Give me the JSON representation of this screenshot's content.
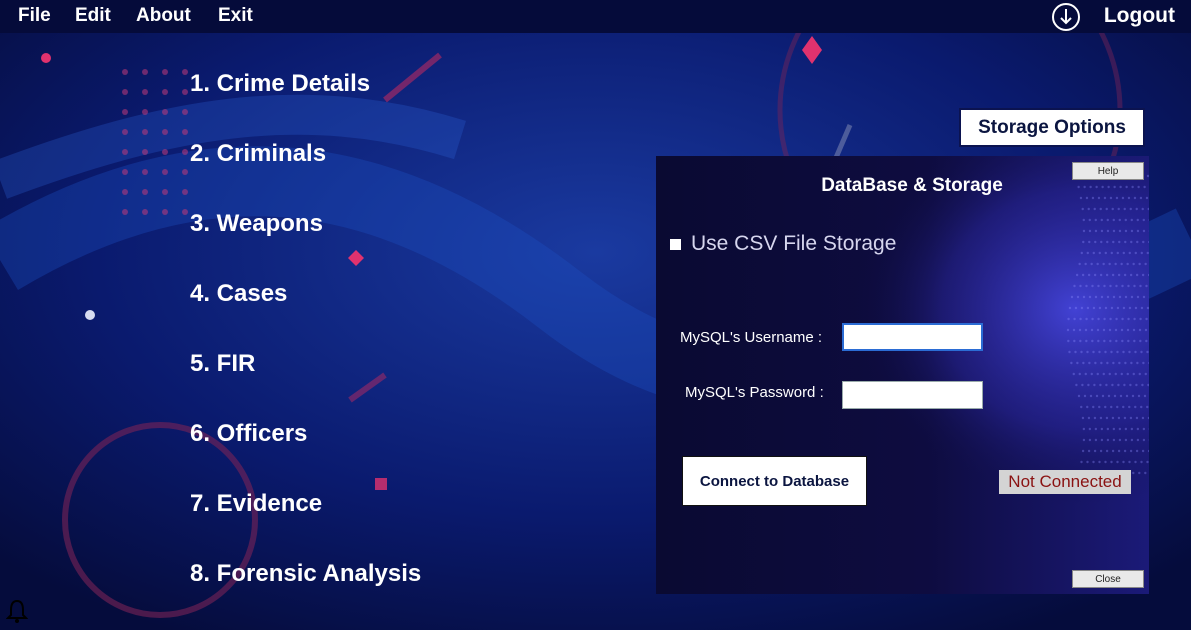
{
  "menubar": {
    "items": [
      "File",
      "Edit",
      "About",
      "Exit"
    ],
    "logout_label": "Logout",
    "logout_icon": "download-circle-icon"
  },
  "nav": {
    "items": [
      "1. Crime Details",
      "2. Criminals",
      "3. Weapons",
      "4. Cases",
      "5. FIR",
      "6. Officers",
      "7. Evidence",
      "8. Forensic Analysis"
    ]
  },
  "storage": {
    "button_label": "Storage Options",
    "panel": {
      "title": "DataBase & Storage",
      "help_label": "Help",
      "close_label": "Close",
      "csv_label": "Use CSV File Storage",
      "csv_checked": false,
      "username_label": "MySQL's Username :",
      "username_value": "",
      "password_label": "MySQL's Password :",
      "password_value": "",
      "connect_label": "Connect to Database",
      "status_text": "Not Connected"
    }
  },
  "colors": {
    "background": "#07104a",
    "accent_pink": "#e0326e",
    "status_text": "#8a1212"
  },
  "icons": {
    "bell": "bell-icon"
  }
}
